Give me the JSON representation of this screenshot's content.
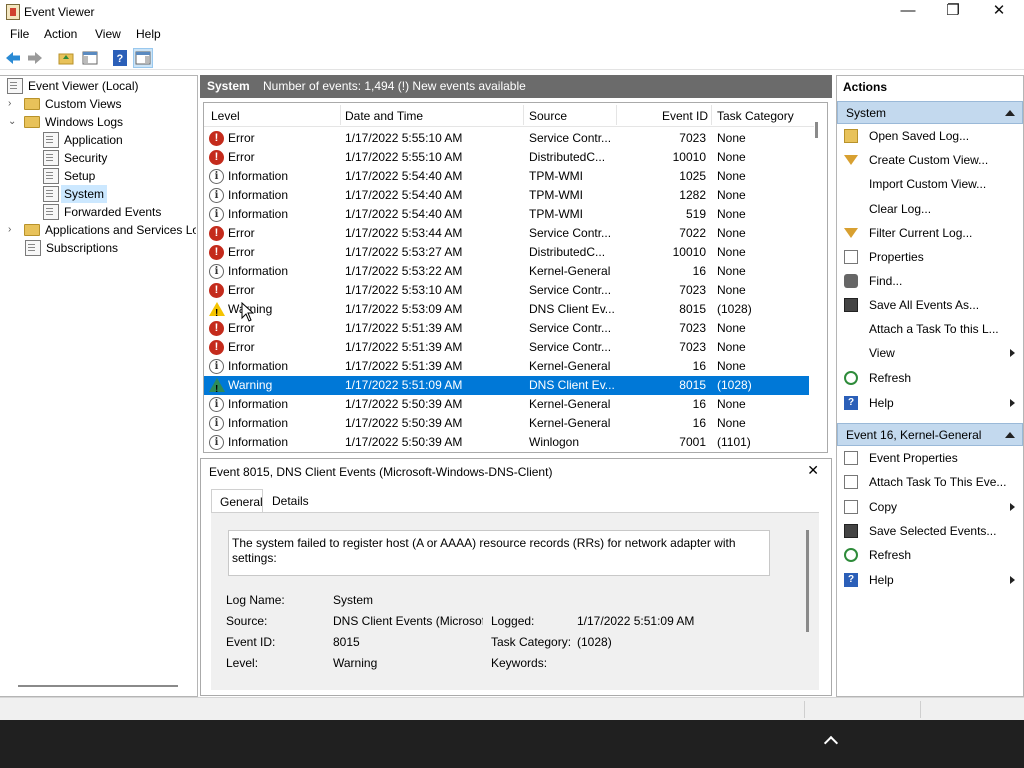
{
  "window": {
    "title": "Event Viewer",
    "minimize": "—",
    "restore": "❐",
    "close": "✕"
  },
  "menu": [
    "File",
    "Action",
    "View",
    "Help"
  ],
  "tree": {
    "items": [
      {
        "label": "Event Viewer (Local)"
      },
      {
        "label": "Custom Views"
      },
      {
        "label": "Windows Logs"
      },
      {
        "label": "Application"
      },
      {
        "label": "Security"
      },
      {
        "label": "Setup"
      },
      {
        "label": "System",
        "selected": true
      },
      {
        "label": "Forwarded Events"
      },
      {
        "label": "Applications and Services Lo"
      },
      {
        "label": "Subscriptions"
      }
    ]
  },
  "center_header": {
    "log_name": "System",
    "info": "Number of events: 1,494 (!) New events available"
  },
  "grid": {
    "columns": [
      "Level",
      "Date and Time",
      "Source",
      "Event ID",
      "Task Category"
    ],
    "rows": [
      {
        "level": "Error",
        "date": "1/17/2022 5:55:10 AM",
        "source": "Service Contr...",
        "id": "7023",
        "cat": "None"
      },
      {
        "level": "Error",
        "date": "1/17/2022 5:55:10 AM",
        "source": "DistributedC...",
        "id": "10010",
        "cat": "None"
      },
      {
        "level": "Information",
        "date": "1/17/2022 5:54:40 AM",
        "source": "TPM-WMI",
        "id": "1025",
        "cat": "None"
      },
      {
        "level": "Information",
        "date": "1/17/2022 5:54:40 AM",
        "source": "TPM-WMI",
        "id": "1282",
        "cat": "None"
      },
      {
        "level": "Information",
        "date": "1/17/2022 5:54:40 AM",
        "source": "TPM-WMI",
        "id": "519",
        "cat": "None"
      },
      {
        "level": "Error",
        "date": "1/17/2022 5:53:44 AM",
        "source": "Service Contr...",
        "id": "7022",
        "cat": "None"
      },
      {
        "level": "Error",
        "date": "1/17/2022 5:53:27 AM",
        "source": "DistributedC...",
        "id": "10010",
        "cat": "None"
      },
      {
        "level": "Information",
        "date": "1/17/2022 5:53:22 AM",
        "source": "Kernel-General",
        "id": "16",
        "cat": "None"
      },
      {
        "level": "Error",
        "date": "1/17/2022 5:53:10 AM",
        "source": "Service Contr...",
        "id": "7023",
        "cat": "None"
      },
      {
        "level": "Warning",
        "date": "1/17/2022 5:53:09 AM",
        "source": "DNS Client Ev...",
        "id": "8015",
        "cat": "(1028)"
      },
      {
        "level": "Error",
        "date": "1/17/2022 5:51:39 AM",
        "source": "Service Contr...",
        "id": "7023",
        "cat": "None"
      },
      {
        "level": "Error",
        "date": "1/17/2022 5:51:39 AM",
        "source": "Service Contr...",
        "id": "7023",
        "cat": "None"
      },
      {
        "level": "Information",
        "date": "1/17/2022 5:51:39 AM",
        "source": "Kernel-General",
        "id": "16",
        "cat": "None"
      },
      {
        "level": "Warning",
        "date": "1/17/2022 5:51:09 AM",
        "source": "DNS Client Ev...",
        "id": "8015",
        "cat": "(1028)",
        "selected": true
      },
      {
        "level": "Information",
        "date": "1/17/2022 5:50:39 AM",
        "source": "Kernel-General",
        "id": "16",
        "cat": "None"
      },
      {
        "level": "Information",
        "date": "1/17/2022 5:50:39 AM",
        "source": "Kernel-General",
        "id": "16",
        "cat": "None"
      },
      {
        "level": "Information",
        "date": "1/17/2022 5:50:39 AM",
        "source": "Winlogon",
        "id": "7001",
        "cat": "(1101)"
      }
    ]
  },
  "detail": {
    "title": "Event 8015, DNS Client Events (Microsoft-Windows-DNS-Client)",
    "close": "✕",
    "tabs": [
      "General",
      "Details"
    ],
    "message": "The system failed to register host (A or AAAA) resource records (RRs) for network adapter with settings:",
    "fields": {
      "log_name_label": "Log Name:",
      "log_name": "System",
      "source_label": "Source:",
      "source": "DNS Client Events (Microsof",
      "logged_label": "Logged:",
      "logged": "1/17/2022 5:51:09 AM",
      "event_id_label": "Event ID:",
      "event_id": "8015",
      "task_cat_label": "Task Category:",
      "task_cat": "(1028)",
      "level_label": "Level:",
      "level": "Warning",
      "keywords_label": "Keywords:",
      "keywords": ""
    }
  },
  "actions": {
    "header": "Actions",
    "section1": {
      "title": "System",
      "items": [
        {
          "label": "Open Saved Log...",
          "icon": "folder-icon"
        },
        {
          "label": "Create Custom View...",
          "icon": "filter-icon"
        },
        {
          "label": "Import Custom View...",
          "icon": ""
        },
        {
          "label": "Clear Log...",
          "icon": ""
        },
        {
          "label": "Filter Current Log...",
          "icon": "filter-icon"
        },
        {
          "label": "Properties",
          "icon": "properties-icon"
        },
        {
          "label": "Find...",
          "icon": "binoculars-icon"
        },
        {
          "label": "Save All Events As...",
          "icon": "save-icon"
        },
        {
          "label": "Attach a Task To this L...",
          "icon": ""
        },
        {
          "label": "View",
          "icon": "",
          "submenu": true
        },
        {
          "label": "Refresh",
          "icon": "refresh-icon"
        },
        {
          "label": "Help",
          "icon": "help-icon",
          "submenu": true
        }
      ]
    },
    "section2": {
      "title": "Event 16, Kernel-General",
      "items": [
        {
          "label": "Event Properties",
          "icon": "properties-icon"
        },
        {
          "label": "Attach Task To This Eve...",
          "icon": "task-icon"
        },
        {
          "label": "Copy",
          "icon": "copy-icon",
          "submenu": true
        },
        {
          "label": "Save Selected Events...",
          "icon": "save-icon"
        },
        {
          "label": "Refresh",
          "icon": "refresh-icon"
        },
        {
          "label": "Help",
          "icon": "help-icon",
          "submenu": true
        }
      ]
    }
  }
}
